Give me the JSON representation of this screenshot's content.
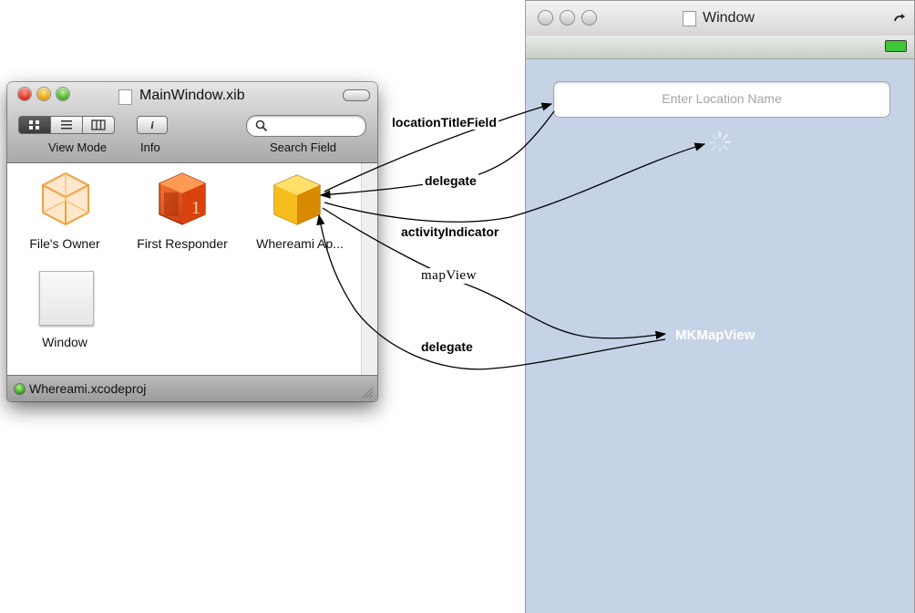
{
  "xib_window": {
    "title": "MainWindow.xib",
    "toolbar": {
      "view_mode_label": "View Mode",
      "info_label": "Info",
      "search_label": "Search Field",
      "info_button_glyph": "i"
    },
    "objects": [
      {
        "label": "File's Owner",
        "icon": "transparent-cube-icon"
      },
      {
        "label": "First Responder",
        "icon": "red-cube-icon"
      },
      {
        "label": "Whereami Ap...",
        "icon": "gold-cube-icon"
      },
      {
        "label": "Window",
        "icon": "window-icon"
      }
    ],
    "status": {
      "project": "Whereami.xcodeproj"
    }
  },
  "ios_window": {
    "title": "Window",
    "text_field_placeholder": "Enter Location Name",
    "map_view_label": "MKMapView"
  },
  "connections": {
    "locationTitleField": "locationTitleField",
    "delegate_field": "delegate",
    "activityIndicator": "activityIndicator",
    "mapView": "mapView",
    "delegate_map": "delegate"
  },
  "colors": {
    "ios_background": "#c6d3e7",
    "toolbar_gray": "#bdbdbd",
    "status_green": "#2d9e12"
  }
}
